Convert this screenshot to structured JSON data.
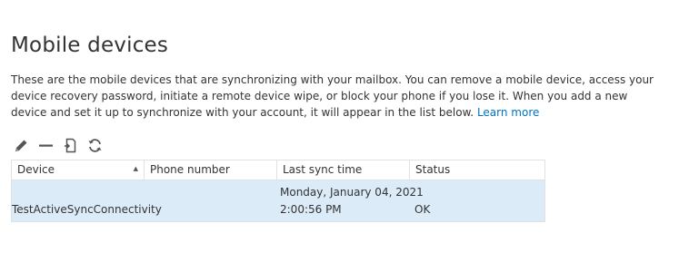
{
  "page": {
    "title": "Mobile devices",
    "description": "These are the mobile devices that are synchronizing with your mailbox. You can remove a mobile device, access your device recovery password, initiate a remote device wipe, or block your phone if you lose it. When you add a new device and set it up to synchronize with your account, it will appear in the list below.",
    "learn_more": "Learn more"
  },
  "toolbar": {
    "icons": [
      "pencil-icon",
      "minus-icon",
      "wipe-device-icon",
      "refresh-icon"
    ]
  },
  "table": {
    "columns": [
      "Device",
      "Phone number",
      "Last sync time",
      "Status"
    ],
    "sorted_column": "Device",
    "sort_direction": "ascending",
    "rows": [
      {
        "device": "TestActiveSyncConnectivity",
        "phone_number": "",
        "last_sync_date": "Monday, January 04, 2021",
        "last_sync_time": "2:00:56 PM",
        "status": "OK"
      }
    ]
  },
  "colors": {
    "link": "#0072c6",
    "selected_row": "#dcebf8",
    "text": "#333333",
    "icon": "#555555"
  }
}
